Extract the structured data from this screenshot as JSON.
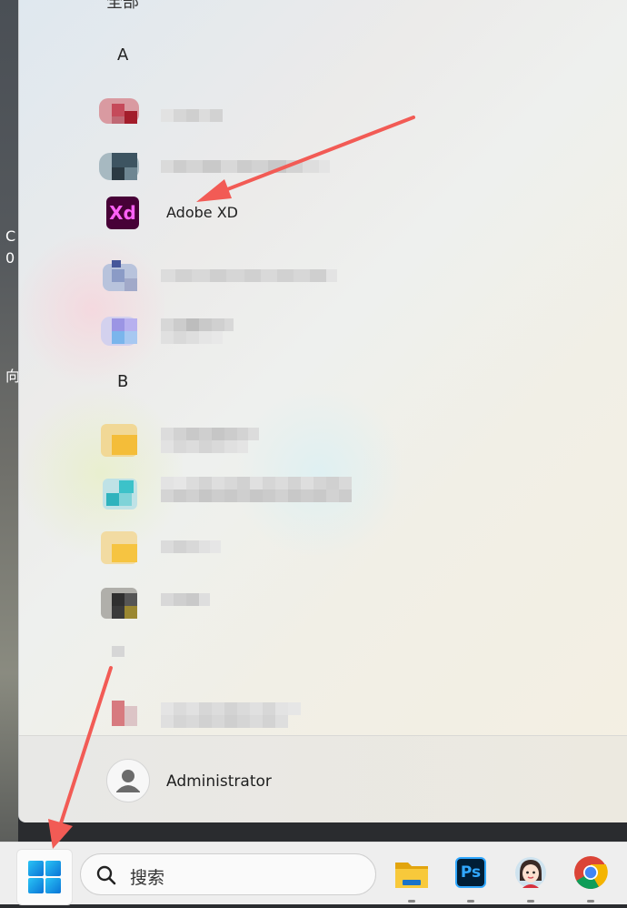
{
  "desktop": {
    "text_fragments": [
      "C",
      "0",
      "向"
    ]
  },
  "start_menu": {
    "top_cut_label": "全部",
    "sections": [
      {
        "letter": "A"
      },
      {
        "letter": "B"
      }
    ],
    "highlighted_app": {
      "name": "Adobe XD",
      "icon_text": "Xd"
    },
    "user": {
      "name": "Administrator"
    }
  },
  "taskbar": {
    "search_placeholder": "搜索",
    "apps": [
      {
        "icon": "file-explorer-icon"
      },
      {
        "icon": "photoshop-icon",
        "text": "Ps"
      },
      {
        "icon": "avatar-app-icon"
      },
      {
        "icon": "chrome-icon"
      }
    ]
  },
  "colors": {
    "annotation": "#f25b55",
    "xd_bg": "#470137",
    "xd_fg": "#ff61f6",
    "ps_bg": "#001e36",
    "ps_fg": "#31a8ff"
  }
}
